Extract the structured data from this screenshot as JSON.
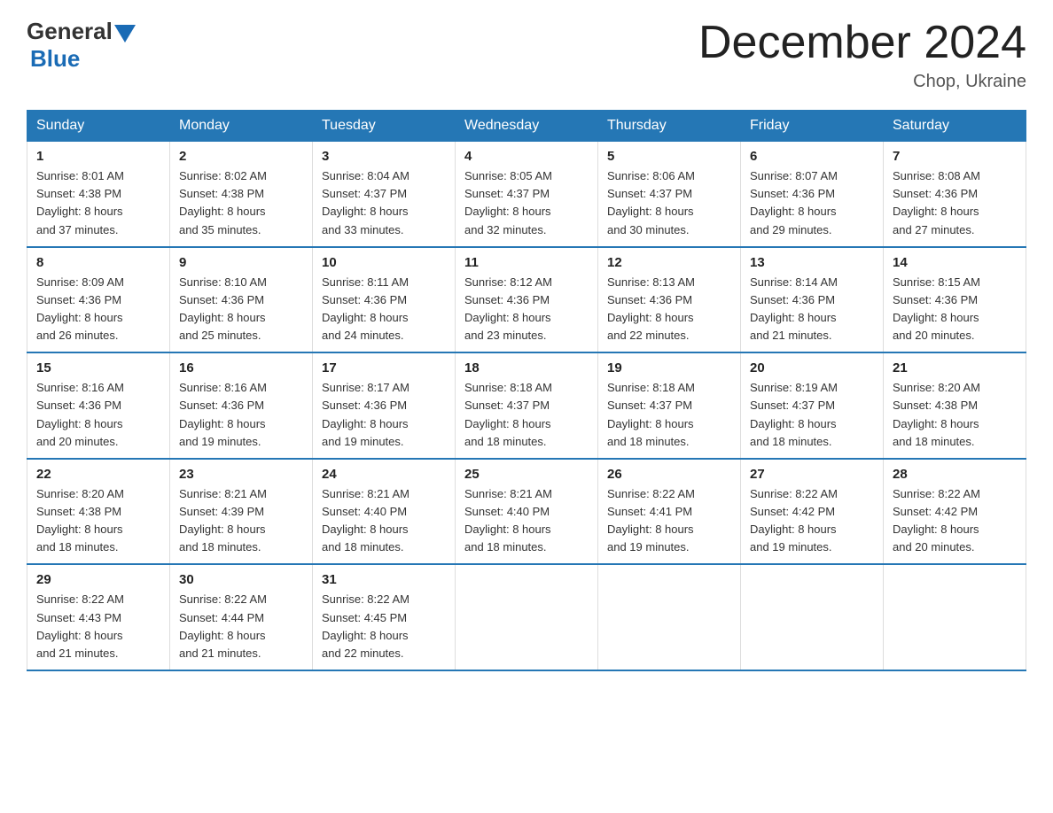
{
  "logo": {
    "general": "General",
    "blue": "Blue"
  },
  "title": "December 2024",
  "location": "Chop, Ukraine",
  "days_of_week": [
    "Sunday",
    "Monday",
    "Tuesday",
    "Wednesday",
    "Thursday",
    "Friday",
    "Saturday"
  ],
  "weeks": [
    [
      {
        "day": "1",
        "info": "Sunrise: 8:01 AM\nSunset: 4:38 PM\nDaylight: 8 hours\nand 37 minutes."
      },
      {
        "day": "2",
        "info": "Sunrise: 8:02 AM\nSunset: 4:38 PM\nDaylight: 8 hours\nand 35 minutes."
      },
      {
        "day": "3",
        "info": "Sunrise: 8:04 AM\nSunset: 4:37 PM\nDaylight: 8 hours\nand 33 minutes."
      },
      {
        "day": "4",
        "info": "Sunrise: 8:05 AM\nSunset: 4:37 PM\nDaylight: 8 hours\nand 32 minutes."
      },
      {
        "day": "5",
        "info": "Sunrise: 8:06 AM\nSunset: 4:37 PM\nDaylight: 8 hours\nand 30 minutes."
      },
      {
        "day": "6",
        "info": "Sunrise: 8:07 AM\nSunset: 4:36 PM\nDaylight: 8 hours\nand 29 minutes."
      },
      {
        "day": "7",
        "info": "Sunrise: 8:08 AM\nSunset: 4:36 PM\nDaylight: 8 hours\nand 27 minutes."
      }
    ],
    [
      {
        "day": "8",
        "info": "Sunrise: 8:09 AM\nSunset: 4:36 PM\nDaylight: 8 hours\nand 26 minutes."
      },
      {
        "day": "9",
        "info": "Sunrise: 8:10 AM\nSunset: 4:36 PM\nDaylight: 8 hours\nand 25 minutes."
      },
      {
        "day": "10",
        "info": "Sunrise: 8:11 AM\nSunset: 4:36 PM\nDaylight: 8 hours\nand 24 minutes."
      },
      {
        "day": "11",
        "info": "Sunrise: 8:12 AM\nSunset: 4:36 PM\nDaylight: 8 hours\nand 23 minutes."
      },
      {
        "day": "12",
        "info": "Sunrise: 8:13 AM\nSunset: 4:36 PM\nDaylight: 8 hours\nand 22 minutes."
      },
      {
        "day": "13",
        "info": "Sunrise: 8:14 AM\nSunset: 4:36 PM\nDaylight: 8 hours\nand 21 minutes."
      },
      {
        "day": "14",
        "info": "Sunrise: 8:15 AM\nSunset: 4:36 PM\nDaylight: 8 hours\nand 20 minutes."
      }
    ],
    [
      {
        "day": "15",
        "info": "Sunrise: 8:16 AM\nSunset: 4:36 PM\nDaylight: 8 hours\nand 20 minutes."
      },
      {
        "day": "16",
        "info": "Sunrise: 8:16 AM\nSunset: 4:36 PM\nDaylight: 8 hours\nand 19 minutes."
      },
      {
        "day": "17",
        "info": "Sunrise: 8:17 AM\nSunset: 4:36 PM\nDaylight: 8 hours\nand 19 minutes."
      },
      {
        "day": "18",
        "info": "Sunrise: 8:18 AM\nSunset: 4:37 PM\nDaylight: 8 hours\nand 18 minutes."
      },
      {
        "day": "19",
        "info": "Sunrise: 8:18 AM\nSunset: 4:37 PM\nDaylight: 8 hours\nand 18 minutes."
      },
      {
        "day": "20",
        "info": "Sunrise: 8:19 AM\nSunset: 4:37 PM\nDaylight: 8 hours\nand 18 minutes."
      },
      {
        "day": "21",
        "info": "Sunrise: 8:20 AM\nSunset: 4:38 PM\nDaylight: 8 hours\nand 18 minutes."
      }
    ],
    [
      {
        "day": "22",
        "info": "Sunrise: 8:20 AM\nSunset: 4:38 PM\nDaylight: 8 hours\nand 18 minutes."
      },
      {
        "day": "23",
        "info": "Sunrise: 8:21 AM\nSunset: 4:39 PM\nDaylight: 8 hours\nand 18 minutes."
      },
      {
        "day": "24",
        "info": "Sunrise: 8:21 AM\nSunset: 4:40 PM\nDaylight: 8 hours\nand 18 minutes."
      },
      {
        "day": "25",
        "info": "Sunrise: 8:21 AM\nSunset: 4:40 PM\nDaylight: 8 hours\nand 18 minutes."
      },
      {
        "day": "26",
        "info": "Sunrise: 8:22 AM\nSunset: 4:41 PM\nDaylight: 8 hours\nand 19 minutes."
      },
      {
        "day": "27",
        "info": "Sunrise: 8:22 AM\nSunset: 4:42 PM\nDaylight: 8 hours\nand 19 minutes."
      },
      {
        "day": "28",
        "info": "Sunrise: 8:22 AM\nSunset: 4:42 PM\nDaylight: 8 hours\nand 20 minutes."
      }
    ],
    [
      {
        "day": "29",
        "info": "Sunrise: 8:22 AM\nSunset: 4:43 PM\nDaylight: 8 hours\nand 21 minutes."
      },
      {
        "day": "30",
        "info": "Sunrise: 8:22 AM\nSunset: 4:44 PM\nDaylight: 8 hours\nand 21 minutes."
      },
      {
        "day": "31",
        "info": "Sunrise: 8:22 AM\nSunset: 4:45 PM\nDaylight: 8 hours\nand 22 minutes."
      },
      {
        "day": "",
        "info": ""
      },
      {
        "day": "",
        "info": ""
      },
      {
        "day": "",
        "info": ""
      },
      {
        "day": "",
        "info": ""
      }
    ]
  ]
}
